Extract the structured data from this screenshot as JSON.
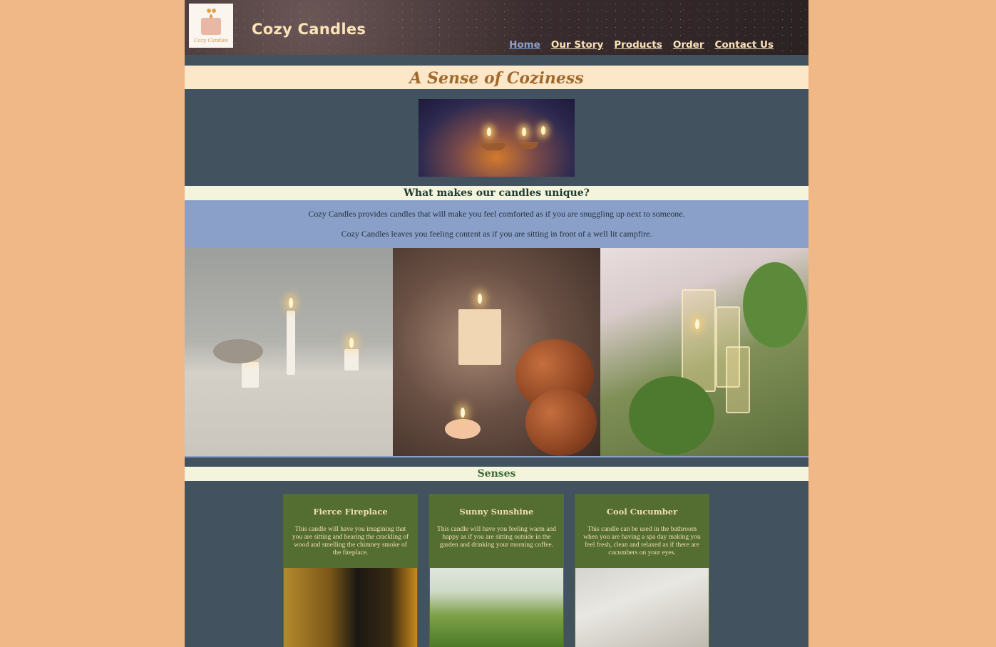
{
  "header": {
    "logo_text": "Cozy Candles",
    "site_title": "Cozy Candles",
    "nav": [
      {
        "label": "Home",
        "active": true
      },
      {
        "label": "Our Story",
        "active": false
      },
      {
        "label": "Products",
        "active": false
      },
      {
        "label": "Order",
        "active": false
      },
      {
        "label": "Contact Us",
        "active": false
      }
    ]
  },
  "banner": {
    "title": "A Sense of Coziness"
  },
  "unique": {
    "heading": "What makes our candles unique?",
    "paragraphs": [
      "Cozy Candles provides candles that will make you feel comforted as if you are snuggling up next to someone.",
      "Cozy Candles leaves you feeling content as if you are sitting in front of a well lit campfire."
    ]
  },
  "senses": {
    "heading": "Senses",
    "cards": [
      {
        "title": "Fierce Fireplace",
        "text": "This candle will have you imagining that you are sitting and hearing the crackling of wood and smelling the chimney smoke of the fireplace."
      },
      {
        "title": "Sunny Sunshine",
        "text": "This candle will have you feeling warm and happy as if you are sitting outside in the garden and drinking your morning coffee."
      },
      {
        "title": "Cool Cucumber",
        "text": "This candle can be used in the bathroom when you are having a spa day making you feel fresh, clean and relaxed as if there are cucumbers on your eyes."
      }
    ]
  },
  "colors": {
    "page_bg": "#f0b886",
    "content_bg": "#42525e",
    "banner_bg": "#fde7c9",
    "heading_bar_bg": "#f4f4dc",
    "info_bg": "#8aa0c9",
    "card_bg": "#546e32",
    "nav_text": "#fbe3b8",
    "nav_active": "#8aa0cb"
  }
}
